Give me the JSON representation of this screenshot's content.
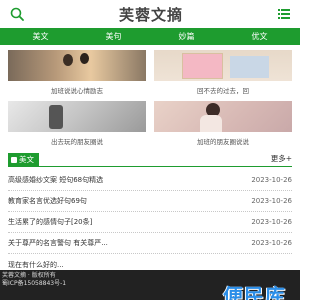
{
  "header": {
    "logo": "芙蓉文摘"
  },
  "nav": {
    "items": [
      "美文",
      "美句",
      "妙篇",
      "优文"
    ]
  },
  "cards": [
    {
      "caption": "加班说说心情励志"
    },
    {
      "caption": "回不去的过去，回"
    },
    {
      "caption": "出去玩的朋友圈说"
    },
    {
      "caption": "加班的朋友圈说说"
    }
  ],
  "section": {
    "title": "美文",
    "more": "更多+"
  },
  "articles": [
    {
      "title": "高级感婚纱文案 短句68句精选",
      "date": "2023-10-26"
    },
    {
      "title": "教育家名言优选好句69句",
      "date": "2023-10-26"
    },
    {
      "title": "生活累了的感情句子[20条]",
      "date": "2023-10-26"
    },
    {
      "title": "关于尊严的名言警句 有关尊严...",
      "date": "2023-10-26"
    },
    {
      "title": "现在有什么好的...",
      "date": ""
    }
  ],
  "footer": {
    "line1": "芙蓉文摘 · 版权所有",
    "line2": "蜀ICP备15058843号-1"
  },
  "watermark": "便民库",
  "colors": {
    "brand_green": "#1e9c2f",
    "footer_bg": "#222222",
    "watermark": "#2b8ee8"
  }
}
